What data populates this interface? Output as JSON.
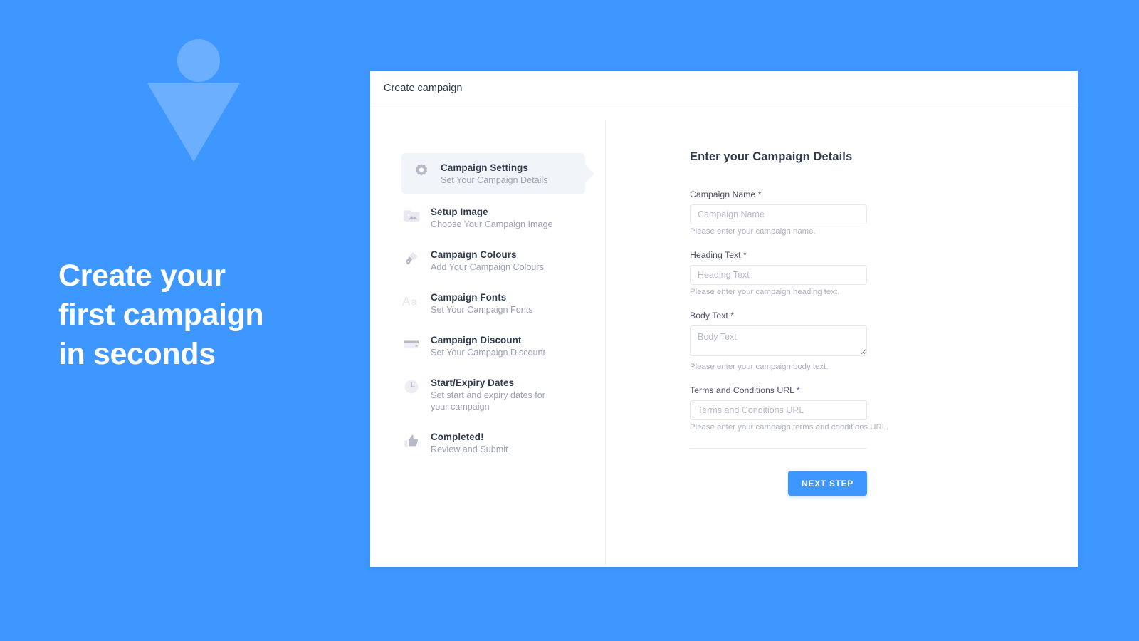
{
  "colors": {
    "background_blue": "#3e97ff",
    "mark_blue": "#6cafff",
    "accent": "#3e97ff",
    "active_step_bg": "#f1f4f8",
    "icon_gray": "#b7b9c9",
    "title_text": "#2f3a4c",
    "muted_text": "#9ba0b3"
  },
  "promo": {
    "headline_lines": [
      "Create your",
      "first campaign",
      "in seconds"
    ],
    "mark": {
      "circle_icon": "circle-shape",
      "triangle_icon": "triangle-down-shape"
    }
  },
  "window": {
    "title": "Create campaign"
  },
  "stepper": {
    "items": [
      {
        "icon": "gear-icon",
        "title": "Campaign Settings",
        "subtitle": "Set Your Campaign Details",
        "active": true
      },
      {
        "icon": "image-icon",
        "title": "Setup Image",
        "subtitle": "Choose Your Campaign Image",
        "active": false
      },
      {
        "icon": "paintbrush-icon",
        "title": "Campaign Colours",
        "subtitle": "Add Your Campaign Colours",
        "active": false
      },
      {
        "icon": "font-icon",
        "title": "Campaign Fonts",
        "subtitle": "Set Your Campaign Fonts",
        "active": false
      },
      {
        "icon": "credit-card-icon",
        "title": "Campaign Discount",
        "subtitle": "Set Your Campaign Discount",
        "active": false
      },
      {
        "icon": "clock-icon",
        "title": "Start/Expiry Dates",
        "subtitle": "Set start and expiry dates for your campaign",
        "active": false
      },
      {
        "icon": "thumbs-up-icon",
        "title": "Completed!",
        "subtitle": "Review and Submit",
        "active": false
      }
    ]
  },
  "form": {
    "heading": "Enter your Campaign Details",
    "fields": [
      {
        "label": "Campaign Name",
        "required_marker": "*",
        "value": "",
        "placeholder": "Campaign Name",
        "help": "Please enter your campaign name.",
        "type": "text"
      },
      {
        "label": "Heading Text",
        "required_marker": "*",
        "value": "",
        "placeholder": "Heading Text",
        "help": "Please enter your campaign heading text.",
        "type": "text"
      },
      {
        "label": "Body Text",
        "required_marker": "*",
        "value": "",
        "placeholder": "Body Text",
        "help": "Please enter your campaign body text.",
        "type": "textarea"
      },
      {
        "label": "Terms and Conditions URL",
        "required_marker": "*",
        "value": "",
        "placeholder": "Terms and Conditions URL",
        "help": "Please enter your campaign terms and conditions URL.",
        "type": "text"
      }
    ],
    "next_button_label": "NEXT STEP"
  }
}
